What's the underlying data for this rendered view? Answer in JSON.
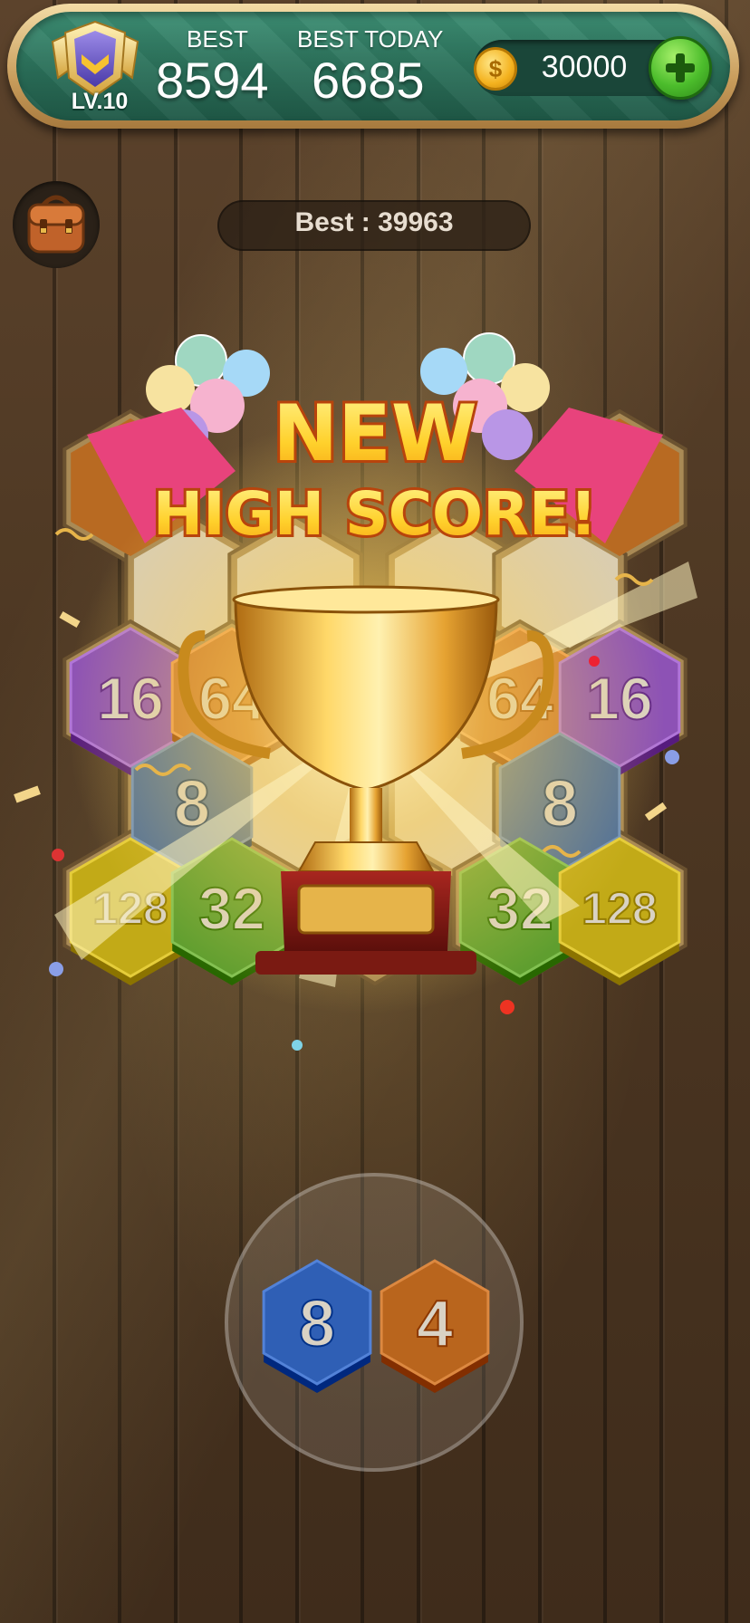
{
  "header": {
    "level_label": "LV.10",
    "best_label": "BEST",
    "best_value": "8594",
    "best_today_label": "BEST TODAY",
    "best_today_value": "6685",
    "coins": "30000",
    "icons": {
      "level": "shield-badge-icon",
      "coin": "coin-icon",
      "add": "plus-icon"
    }
  },
  "bag": {
    "icon": "backpack-icon"
  },
  "best_pill": {
    "text": "Best : 39963"
  },
  "celebration": {
    "line1": "NEW",
    "line2": "HIGH SCORE!",
    "icon": "trophy-icon"
  },
  "board": {
    "tiles": [
      {
        "value": "16",
        "color": "#8d52b5"
      },
      {
        "value": "64",
        "color": "#c8742a"
      },
      {
        "value": "64",
        "color": "#c8742a"
      },
      {
        "value": "16",
        "color": "#8d52b5"
      },
      {
        "value": "8",
        "color": "#4e6f99"
      },
      {
        "value": "8",
        "color": "#4e6f99"
      },
      {
        "value": "128",
        "color": "#c2aa17"
      },
      {
        "value": "32",
        "color": "#5f9e2f"
      },
      {
        "value": "32",
        "color": "#5f9e2f"
      },
      {
        "value": "128",
        "color": "#c2aa17"
      }
    ]
  },
  "tray": {
    "pieces": [
      {
        "value": "8",
        "color": "#2f5fb5"
      },
      {
        "value": "4",
        "color": "#b9651d"
      }
    ]
  },
  "colors": {
    "header_green": "#2a6e58",
    "frame_gold": "#c99d5c",
    "trophy_gold": "#f0b63a",
    "title_yellow": "#ffd733",
    "title_outline": "#b8440c",
    "ribbon_pink": "#e8437c"
  }
}
